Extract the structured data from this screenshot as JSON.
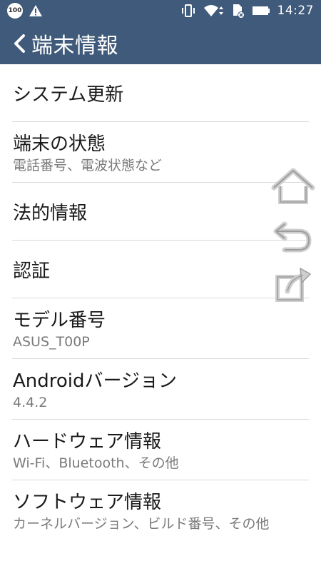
{
  "status_bar": {
    "battery_badge": "100",
    "time": "14:27"
  },
  "action_bar": {
    "title": "端末情報"
  },
  "items": [
    {
      "title": "システム更新",
      "subtitle": ""
    },
    {
      "title": "端末の状態",
      "subtitle": "電話番号、電波状態など"
    },
    {
      "title": "法的情報",
      "subtitle": ""
    },
    {
      "title": "認証",
      "subtitle": ""
    },
    {
      "title": "モデル番号",
      "subtitle": "ASUS_T00P"
    },
    {
      "title": "Androidバージョン",
      "subtitle": "4.4.2"
    },
    {
      "title": "ハードウェア情報",
      "subtitle": "Wi-Fi、Bluetooth、その他"
    },
    {
      "title": "ソフトウェア情報",
      "subtitle": "カーネルバージョン、ビルド番号、その他"
    }
  ],
  "colors": {
    "bar": "#3f5a7a",
    "text_primary": "#1a1a1a",
    "text_secondary": "#7a7a7a",
    "divider": "#d9d9d9"
  }
}
